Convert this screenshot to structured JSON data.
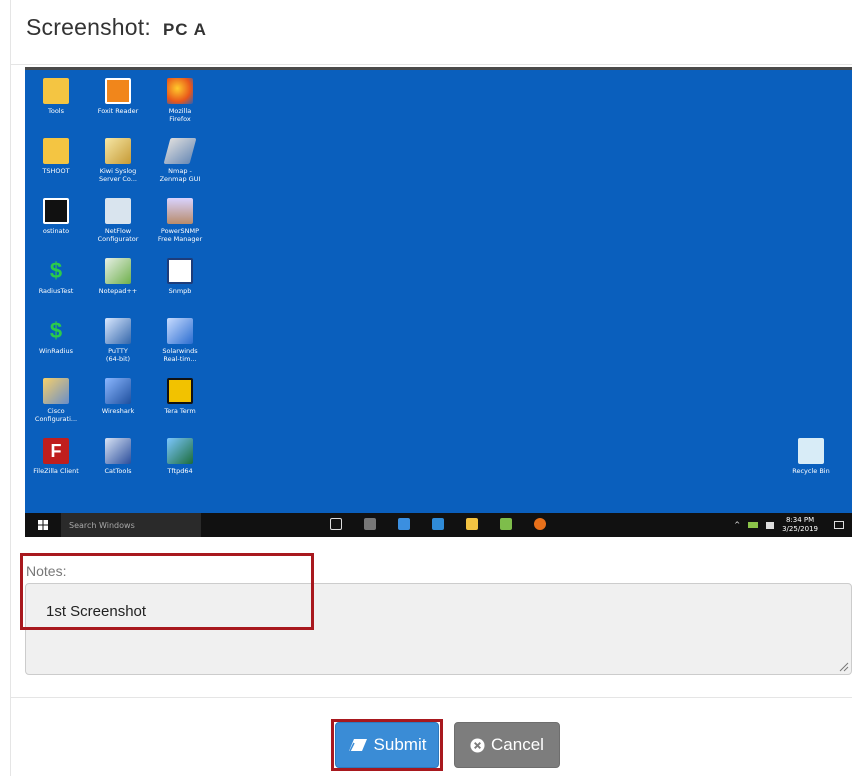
{
  "header": {
    "title": "Screenshot:",
    "subtitle": "PC A"
  },
  "desktop": {
    "background_color": "#0a5fbd",
    "icons": [
      {
        "label": "Tools",
        "icon": "folder-icon"
      },
      {
        "label": "Foxit Reader",
        "icon": "foxit-icon"
      },
      {
        "label": "Mozilla\nFirefox",
        "icon": "firefox-icon"
      },
      {
        "label": "TSHOOT",
        "icon": "folder-icon"
      },
      {
        "label": "Kiwi Syslog\nServer Co...",
        "icon": "kiwi-icon"
      },
      {
        "label": "Nmap -\nZenmap GUI",
        "icon": "nmap-icon"
      },
      {
        "label": "ostinato",
        "icon": "ostinato-icon"
      },
      {
        "label": "NetFlow\nConfigurator",
        "icon": "netflow-icon"
      },
      {
        "label": "PowerSNMP\nFree Manager",
        "icon": "powersnmp-icon"
      },
      {
        "label": "RadiusTest",
        "icon": "radius-icon"
      },
      {
        "label": "Notepad++",
        "icon": "notepad-icon"
      },
      {
        "label": "Snmpb",
        "icon": "snmpb-icon"
      },
      {
        "label": "WinRadius",
        "icon": "winradius-icon"
      },
      {
        "label": "PuTTY\n(64-bit)",
        "icon": "putty-icon"
      },
      {
        "label": "Solarwinds\nReal-tim...",
        "icon": "solarwinds-icon"
      },
      {
        "label": "Cisco\nConfigurati...",
        "icon": "cisco-config-icon"
      },
      {
        "label": "Wireshark",
        "icon": "wireshark-icon"
      },
      {
        "label": "Tera Term",
        "icon": "teraterm-icon"
      },
      {
        "label": "FileZilla Client",
        "icon": "filezilla-icon"
      },
      {
        "label": "CatTools",
        "icon": "cattools-icon"
      },
      {
        "label": "Tftpd64",
        "icon": "tftpd-icon"
      }
    ],
    "recycle_bin": {
      "label": "Recycle Bin",
      "icon": "recycle-bin-icon"
    },
    "taskbar": {
      "search_placeholder": "Search Windows",
      "time": "8:34 PM",
      "date": "3/25/2019"
    }
  },
  "notes": {
    "label": "Notes:",
    "value": "1st Screenshot"
  },
  "footer": {
    "submit_label": "Submit",
    "cancel_label": "Cancel"
  },
  "colors": {
    "highlight": "#a8181e",
    "submit": "#3a8cd6",
    "cancel": "#7d7d7d"
  }
}
